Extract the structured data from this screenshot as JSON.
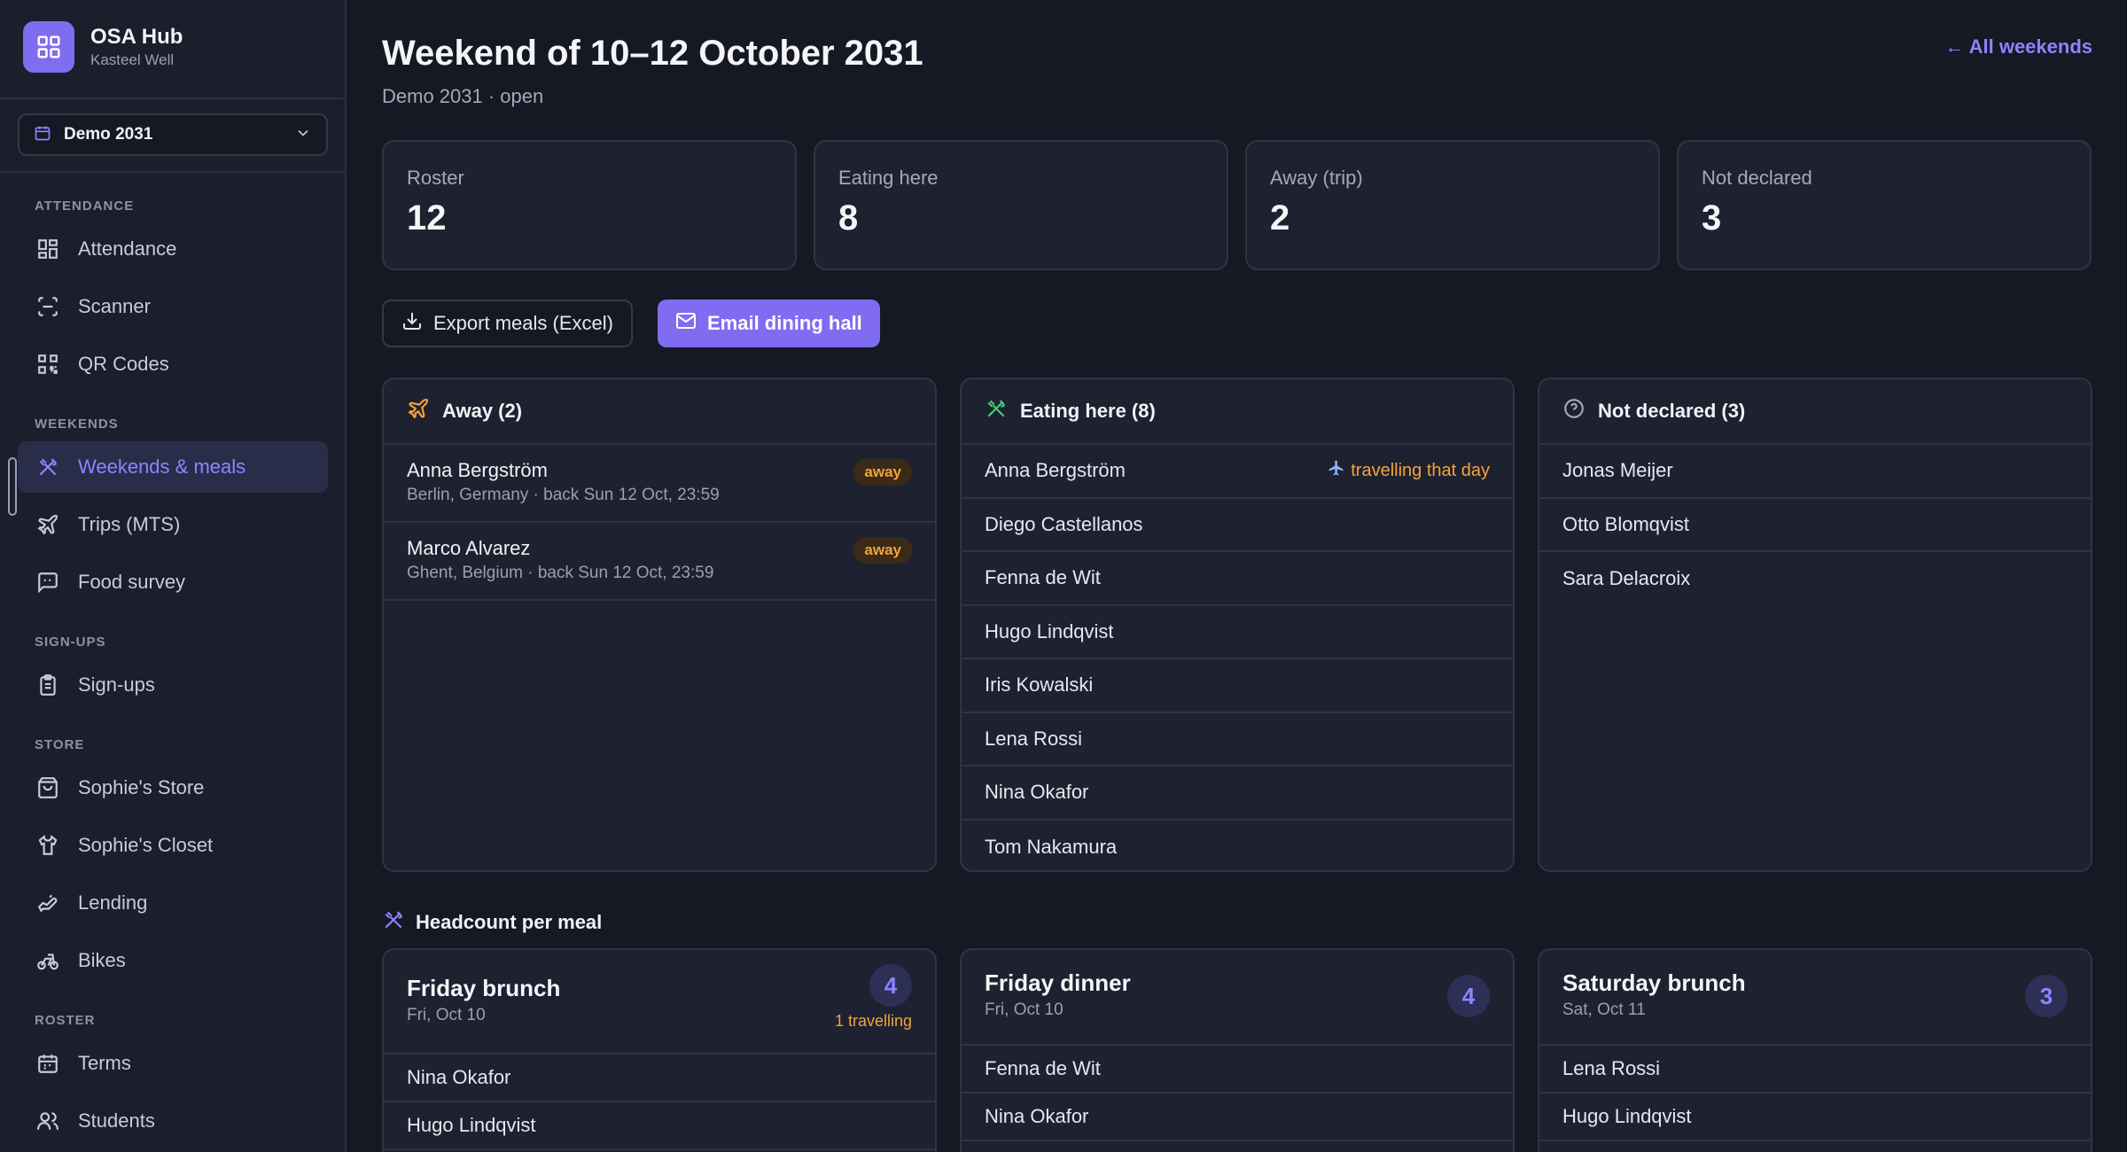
{
  "brand": {
    "title": "OSA Hub",
    "subtitle": "Kasteel Well"
  },
  "term_select": {
    "label": "Demo 2031"
  },
  "nav": {
    "groups": [
      {
        "title": "ATTENDANCE",
        "items": [
          {
            "label": "Attendance",
            "icon": "grid-icon"
          },
          {
            "label": "Scanner",
            "icon": "scan-icon"
          },
          {
            "label": "QR Codes",
            "icon": "qr-code-icon"
          }
        ]
      },
      {
        "title": "WEEKENDS",
        "items": [
          {
            "label": "Weekends & meals",
            "icon": "utensils-icon",
            "active": true
          },
          {
            "label": "Trips (MTS)",
            "icon": "plane-icon"
          },
          {
            "label": "Food survey",
            "icon": "message-square-icon"
          }
        ]
      },
      {
        "title": "SIGN-UPS",
        "items": [
          {
            "label": "Sign-ups",
            "icon": "clipboard-icon"
          }
        ]
      },
      {
        "title": "STORE",
        "items": [
          {
            "label": "Sophie's Store",
            "icon": "shopping-bag-icon"
          },
          {
            "label": "Sophie's Closet",
            "icon": "shirt-icon"
          },
          {
            "label": "Lending",
            "icon": "hand-icon"
          },
          {
            "label": "Bikes",
            "icon": "bike-icon"
          }
        ]
      },
      {
        "title": "ROSTER",
        "items": [
          {
            "label": "Terms",
            "icon": "calendar-icon"
          },
          {
            "label": "Students",
            "icon": "users-icon"
          }
        ]
      }
    ]
  },
  "header": {
    "title": "Weekend of 10–12 October 2031",
    "subtitle": "Demo 2031 · open",
    "back_link": "← All weekends"
  },
  "stats": [
    {
      "label": "Roster",
      "value": "12"
    },
    {
      "label": "Eating here",
      "value": "8"
    },
    {
      "label": "Away (trip)",
      "value": "2"
    },
    {
      "label": "Not declared",
      "value": "3"
    }
  ],
  "actions": {
    "export_label": "Export meals (Excel)",
    "email_label": "Email dining hall"
  },
  "away_panel": {
    "title": "Away (2)",
    "rows": [
      {
        "name": "Anna Bergström",
        "detail": "Berlin, Germany · back Sun 12 Oct, 23:59",
        "badge": "away"
      },
      {
        "name": "Marco Alvarez",
        "detail": "Ghent, Belgium · back Sun 12 Oct, 23:59",
        "badge": "away"
      }
    ]
  },
  "eating_panel": {
    "title": "Eating here (8)",
    "travel_note": "travelling that day",
    "rows": [
      "Anna Bergström",
      "Diego Castellanos",
      "Fenna de Wit",
      "Hugo Lindqvist",
      "Iris Kowalski",
      "Lena Rossi",
      "Nina Okafor",
      "Tom Nakamura"
    ]
  },
  "undeclared_panel": {
    "title": "Not declared (3)",
    "rows": [
      "Jonas Meijer",
      "Otto Blomqvist",
      "Sara Delacroix"
    ]
  },
  "headcount": {
    "title": "Headcount per meal",
    "meals": [
      {
        "title": "Friday brunch",
        "date": "Fri, Oct 10",
        "count": "4",
        "travelling": "1 travelling",
        "rows": [
          "Nina Okafor",
          "Hugo Lindqvist"
        ]
      },
      {
        "title": "Friday dinner",
        "date": "Fri, Oct 10",
        "count": "4",
        "rows": [
          "Fenna de Wit",
          "Nina Okafor"
        ]
      },
      {
        "title": "Saturday brunch",
        "date": "Sat, Oct 11",
        "count": "3",
        "rows": [
          "Lena Rossi",
          "Hugo Lindqvist"
        ]
      }
    ]
  },
  "colors": {
    "accent": "#7f6cf0",
    "away": "#f3a33b",
    "eating": "#3ecf7a",
    "background": "#161823"
  }
}
